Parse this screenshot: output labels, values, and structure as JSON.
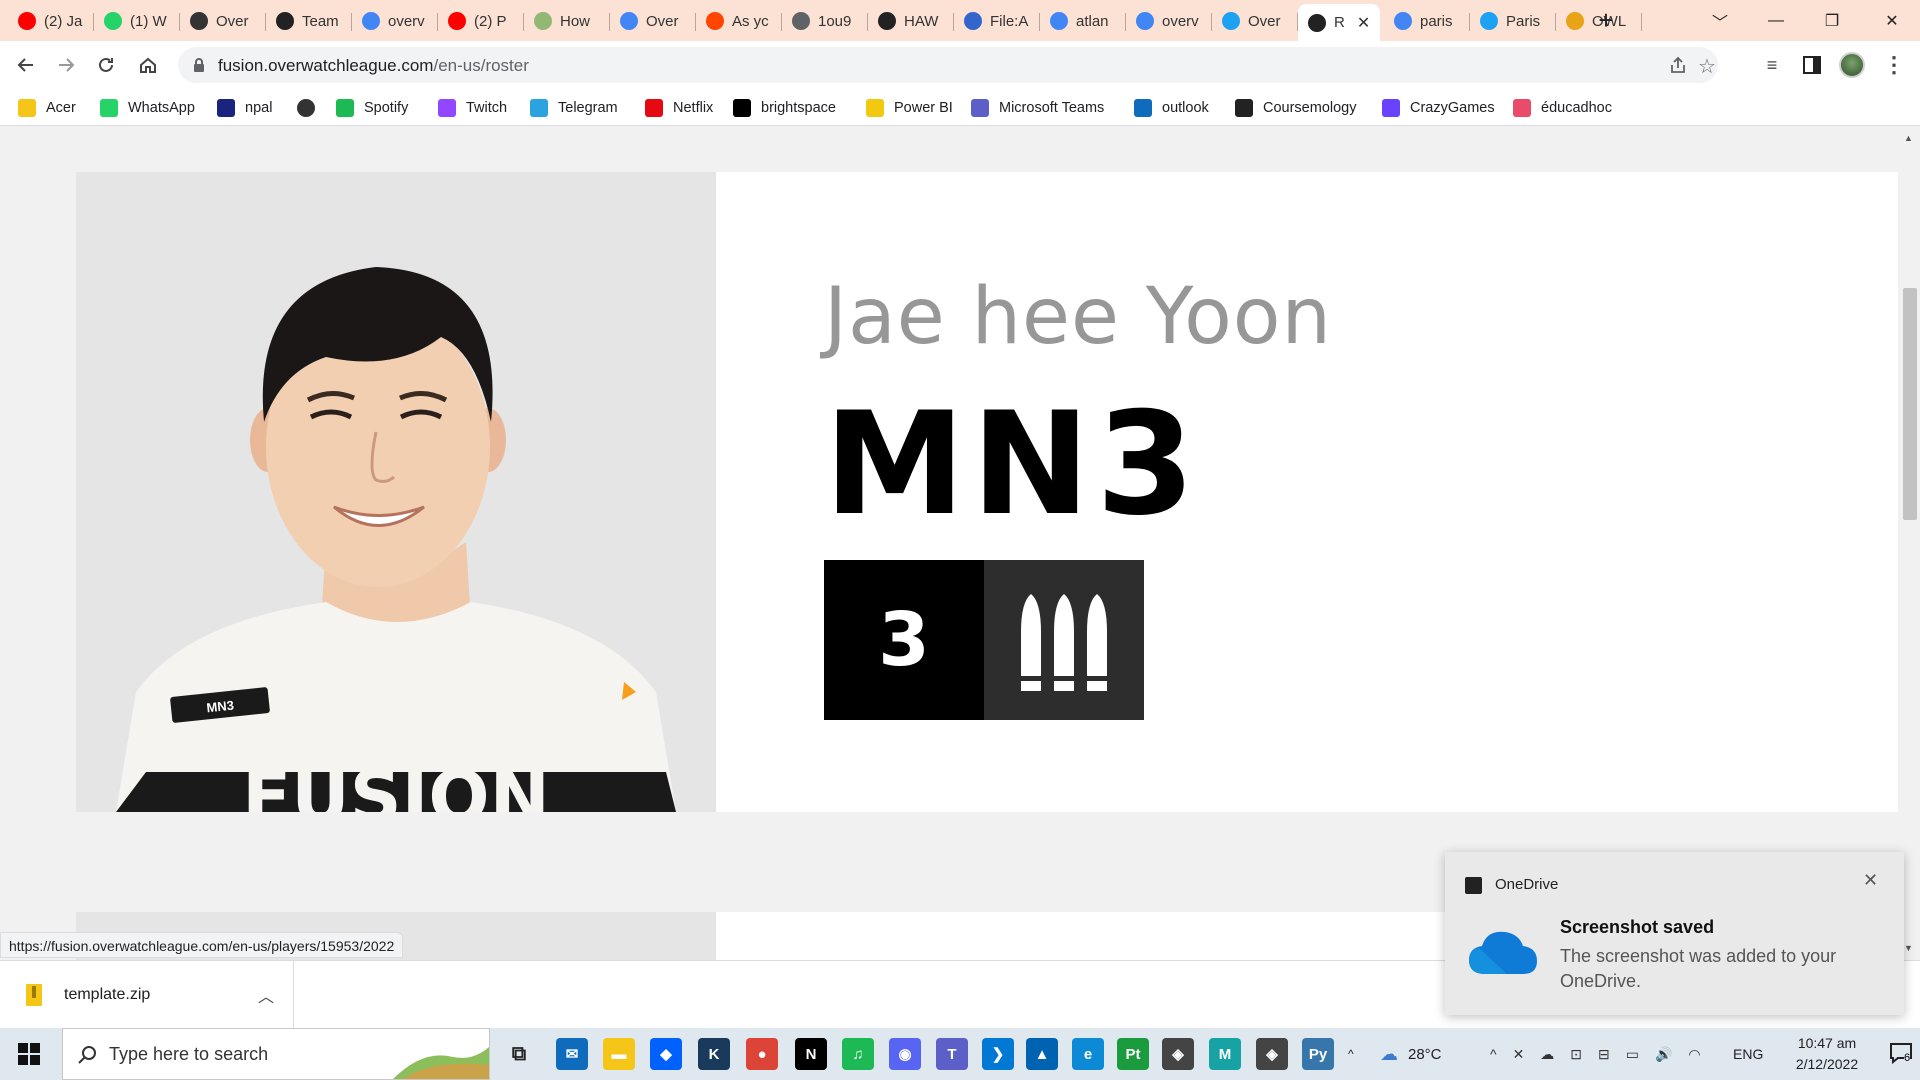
{
  "browser": {
    "tabs": [
      {
        "label": "(2) Ja",
        "icon": "youtube-icon",
        "color": "#ff0000"
      },
      {
        "label": "(1) W",
        "icon": "whatsapp-icon",
        "color": "#25d366"
      },
      {
        "label": "Over",
        "icon": "overwatch-icon",
        "color": "#333333"
      },
      {
        "label": "Team",
        "icon": "owl-icon",
        "color": "#222222"
      },
      {
        "label": "overv",
        "icon": "google-icon",
        "color": "#4285f4"
      },
      {
        "label": "(2) P",
        "icon": "youtube-icon",
        "color": "#ff0000"
      },
      {
        "label": "How",
        "icon": "wikihow-icon",
        "color": "#93b874"
      },
      {
        "label": "Over",
        "icon": "google-icon",
        "color": "#4285f4"
      },
      {
        "label": "As yc",
        "icon": "reddit-icon",
        "color": "#ff4500"
      },
      {
        "label": "1ou9",
        "icon": "globe-icon",
        "color": "#5f6368"
      },
      {
        "label": "HAW",
        "icon": "owl-icon",
        "color": "#222222"
      },
      {
        "label": "File:A",
        "icon": "wikimedia-icon",
        "color": "#3366cc"
      },
      {
        "label": "atlan",
        "icon": "google-icon",
        "color": "#4285f4"
      },
      {
        "label": "overv",
        "icon": "google-icon",
        "color": "#4285f4"
      },
      {
        "label": "Over",
        "icon": "twitter-icon",
        "color": "#1da1f2"
      },
      {
        "label": "R",
        "icon": "owl-icon",
        "color": "#222222",
        "active": true
      },
      {
        "label": "paris",
        "icon": "google-icon",
        "color": "#4285f4"
      },
      {
        "label": "Paris",
        "icon": "twitter-icon",
        "color": "#1da1f2"
      },
      {
        "label": "OWL",
        "icon": "owl-coin-icon",
        "color": "#e8a317"
      }
    ],
    "url_host": "fusion.overwatchleague.com",
    "url_path": "/en-us/roster",
    "bookmarks": [
      {
        "label": "Acer",
        "icon": "folder-icon",
        "color": "#f5c518"
      },
      {
        "label": "WhatsApp",
        "icon": "whatsapp-icon",
        "color": "#25d366"
      },
      {
        "label": "npal",
        "icon": "npal-icon",
        "color": "#1a237e"
      },
      {
        "label": "",
        "icon": "globe-icon",
        "color": "#333333"
      },
      {
        "label": "Spotify",
        "icon": "spotify-icon",
        "color": "#1db954"
      },
      {
        "label": "Twitch",
        "icon": "twitch-icon",
        "color": "#9146ff"
      },
      {
        "label": "Telegram",
        "icon": "telegram-icon",
        "color": "#2aa3e0"
      },
      {
        "label": "Netflix",
        "icon": "netflix-icon",
        "color": "#e50914"
      },
      {
        "label": "brightspace",
        "icon": "np-icon",
        "color": "#000000"
      },
      {
        "label": "Power BI",
        "icon": "powerbi-icon",
        "color": "#f2c811"
      },
      {
        "label": "Microsoft Teams",
        "icon": "teams-icon",
        "color": "#5b5fc7"
      },
      {
        "label": "outlook",
        "icon": "outlook-icon",
        "color": "#0f6cbd"
      },
      {
        "label": "Coursemology",
        "icon": "coursemology-icon",
        "color": "#222222"
      },
      {
        "label": "CrazyGames",
        "icon": "crazygames-icon",
        "color": "#6842ff"
      },
      {
        "label": "éducadhoc",
        "icon": "educadhoc-icon",
        "color": "#e94b6a"
      }
    ],
    "status_url": "https://fusion.overwatchleague.com/en-us/players/15953/2022"
  },
  "player": {
    "real_name": "Jae hee Yoon",
    "handle": "MN3",
    "jersey_number": "3",
    "role": "damage",
    "jersey_text": "MN3",
    "jersey_logo": "FUSION"
  },
  "downloads": {
    "file_name": "template.zip"
  },
  "toast": {
    "app": "OneDrive",
    "title": "Screenshot saved",
    "body": "The screenshot was added to your OneDrive."
  },
  "taskbar": {
    "search_placeholder": "Type here to search",
    "weather": "28°C",
    "language": "ENG",
    "time": "10:47 am",
    "date": "2/12/2022",
    "notification_count": "6",
    "apps": [
      {
        "icon": "task-view-icon",
        "color": "#dfe7ef",
        "glyph": "⧉"
      },
      {
        "icon": "mail-icon",
        "color": "#0f6cbd",
        "glyph": "✉"
      },
      {
        "icon": "file-explorer-icon",
        "color": "#f5c518",
        "glyph": "▬"
      },
      {
        "icon": "dropbox-icon",
        "color": "#0061fe",
        "glyph": "◆"
      },
      {
        "icon": "kindle-icon",
        "color": "#1a3a5c",
        "glyph": "K"
      },
      {
        "icon": "chrome-icon",
        "color": "#db4437",
        "glyph": "●"
      },
      {
        "icon": "netflix-icon",
        "color": "#000000",
        "glyph": "N"
      },
      {
        "icon": "spotify-icon",
        "color": "#1db954",
        "glyph": "♫"
      },
      {
        "icon": "discord-icon",
        "color": "#5865f2",
        "glyph": "◉"
      },
      {
        "icon": "teams-icon",
        "color": "#5b5fc7",
        "glyph": "T"
      },
      {
        "icon": "vscode-icon",
        "color": "#0078d4",
        "glyph": "❯"
      },
      {
        "icon": "photos-icon",
        "color": "#0063b1",
        "glyph": "▲"
      },
      {
        "icon": "edge-icon",
        "color": "#0c8ad6",
        "glyph": "e"
      },
      {
        "icon": "pt-icon",
        "color": "#1a9c3e",
        "glyph": "Pt"
      },
      {
        "icon": "unity-icon",
        "color": "#444444",
        "glyph": "◈"
      },
      {
        "icon": "maya-icon",
        "color": "#17a3a4",
        "glyph": "M"
      },
      {
        "icon": "unity-hub-icon",
        "color": "#444444",
        "glyph": "◈"
      },
      {
        "icon": "python-icon",
        "color": "#3776ab",
        "glyph": "Py"
      }
    ]
  },
  "colors": {
    "page_background": "#f1f1f1",
    "name_gray": "#979797",
    "accent_orange": "#f99e1a"
  }
}
